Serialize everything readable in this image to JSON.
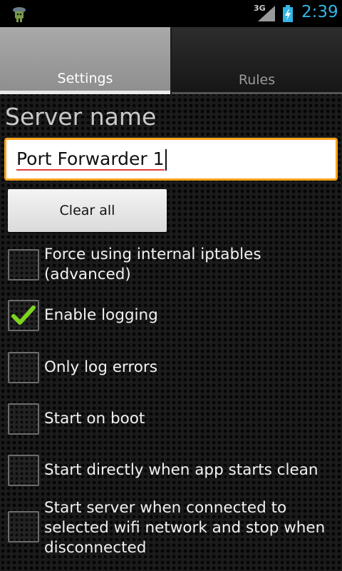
{
  "status_bar": {
    "network_type": "3G",
    "time": "2:39",
    "icons": [
      "android-app-icon",
      "signal-icon",
      "battery-charging-icon"
    ],
    "clock_color": "#33b5e5"
  },
  "tabs": [
    {
      "label": "Settings",
      "selected": true
    },
    {
      "label": "Rules",
      "selected": false
    }
  ],
  "server": {
    "label": "Server name",
    "value": "Port Forwarder 1"
  },
  "clear_button": {
    "label": "Clear all"
  },
  "options": [
    {
      "label": "Force using internal iptables (advanced)",
      "checked": false
    },
    {
      "label": "Enable logging",
      "checked": true
    },
    {
      "label": "Only log errors",
      "checked": false
    },
    {
      "label": "Start on boot",
      "checked": false
    },
    {
      "label": "Start directly when app starts clean",
      "checked": false
    },
    {
      "label": "Start server when connected to selected wifi network and stop when disconnected",
      "checked": false
    }
  ],
  "colors": {
    "accent_focus": "#ffa31a",
    "check": "#7fd321",
    "spellcheck_underline": "#e04040"
  }
}
